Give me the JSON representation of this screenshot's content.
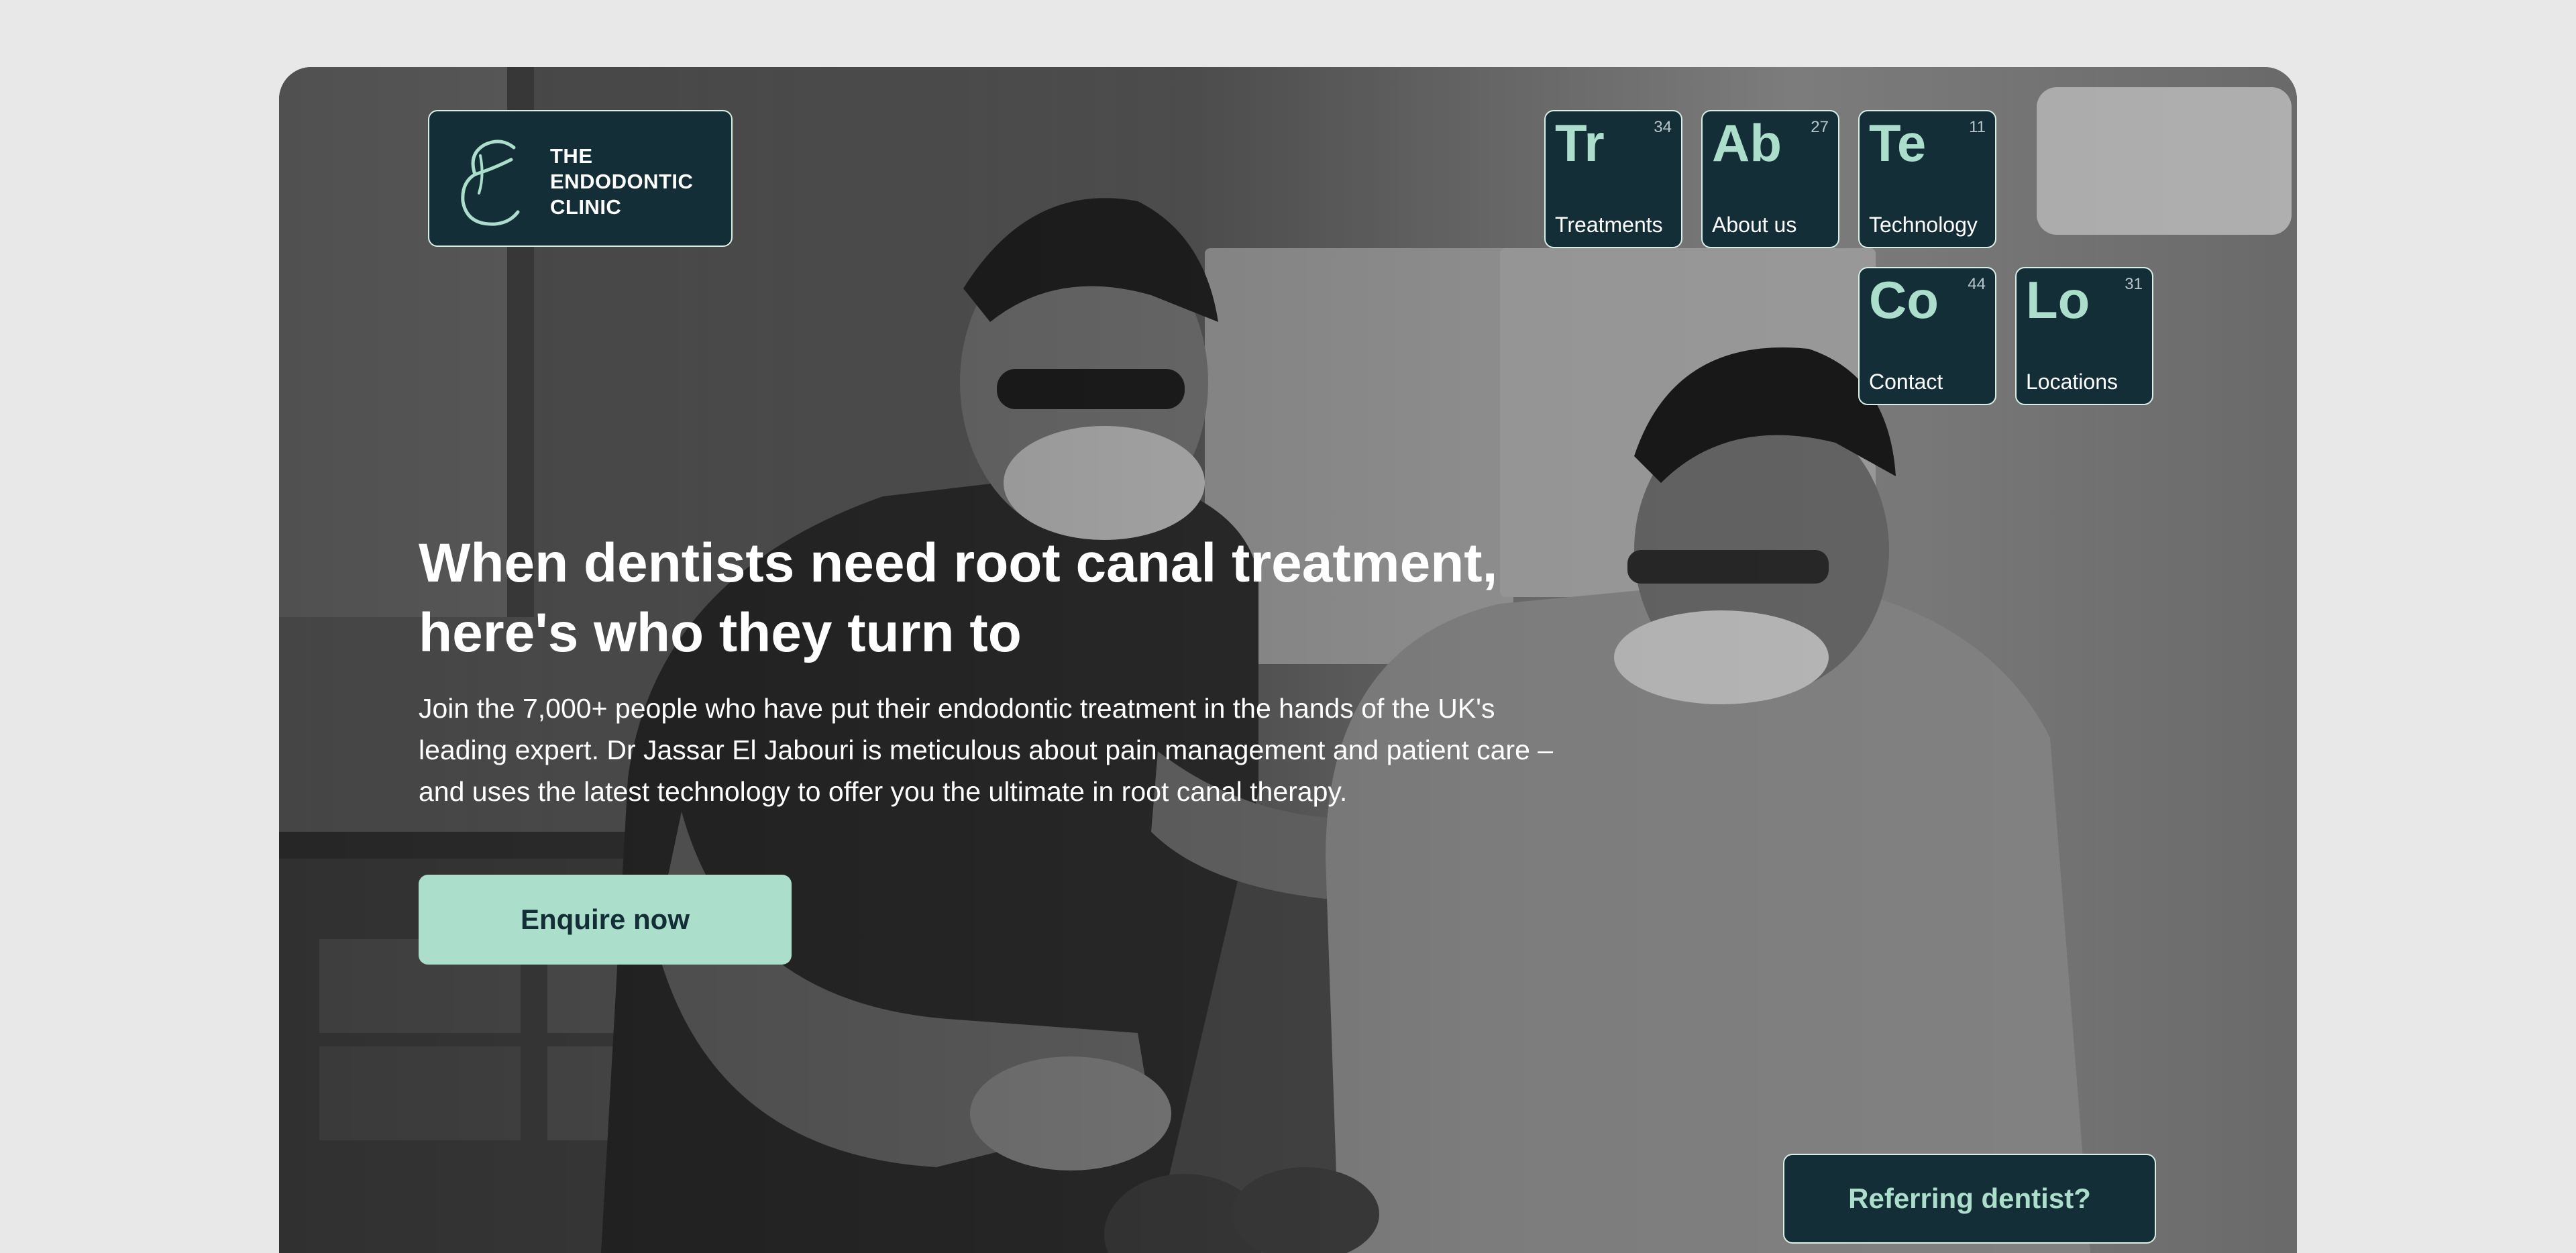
{
  "brand": {
    "name_lines": [
      "THE",
      "ENDODONTIC",
      "CLINIC"
    ],
    "monogram": "E"
  },
  "nav": {
    "tiles": [
      {
        "symbol": "Tr",
        "number": "34",
        "label": "Treatments"
      },
      {
        "symbol": "Ab",
        "number": "27",
        "label": "About us"
      },
      {
        "symbol": "Te",
        "number": "11",
        "label": "Technology"
      },
      {
        "symbol": "Co",
        "number": "44",
        "label": "Contact"
      },
      {
        "symbol": "Lo",
        "number": "31",
        "label": "Locations"
      }
    ]
  },
  "hero": {
    "headline_line1": "When dentists need root canal treatment,",
    "headline_line2": "here's who they turn to",
    "intro": "Join the 7,000+ people who have put their endodontic treatment in the hands of the UK's leading expert. Dr Jassar El Jabouri is meticulous about pain management and patient care – and uses the latest technology to offer you the ultimate in root canal therapy.",
    "cta_label": "Enquire now",
    "referring_label": "Referring dentist?"
  },
  "colors": {
    "page_background": "#e8e8e8",
    "brand_dark": "#142e37",
    "mint_accent": "#acdfcb",
    "tile_border": "#d9efe6",
    "text_white": "#ffffff"
  },
  "icons": {
    "logo": "signature-e-logo-icon"
  }
}
